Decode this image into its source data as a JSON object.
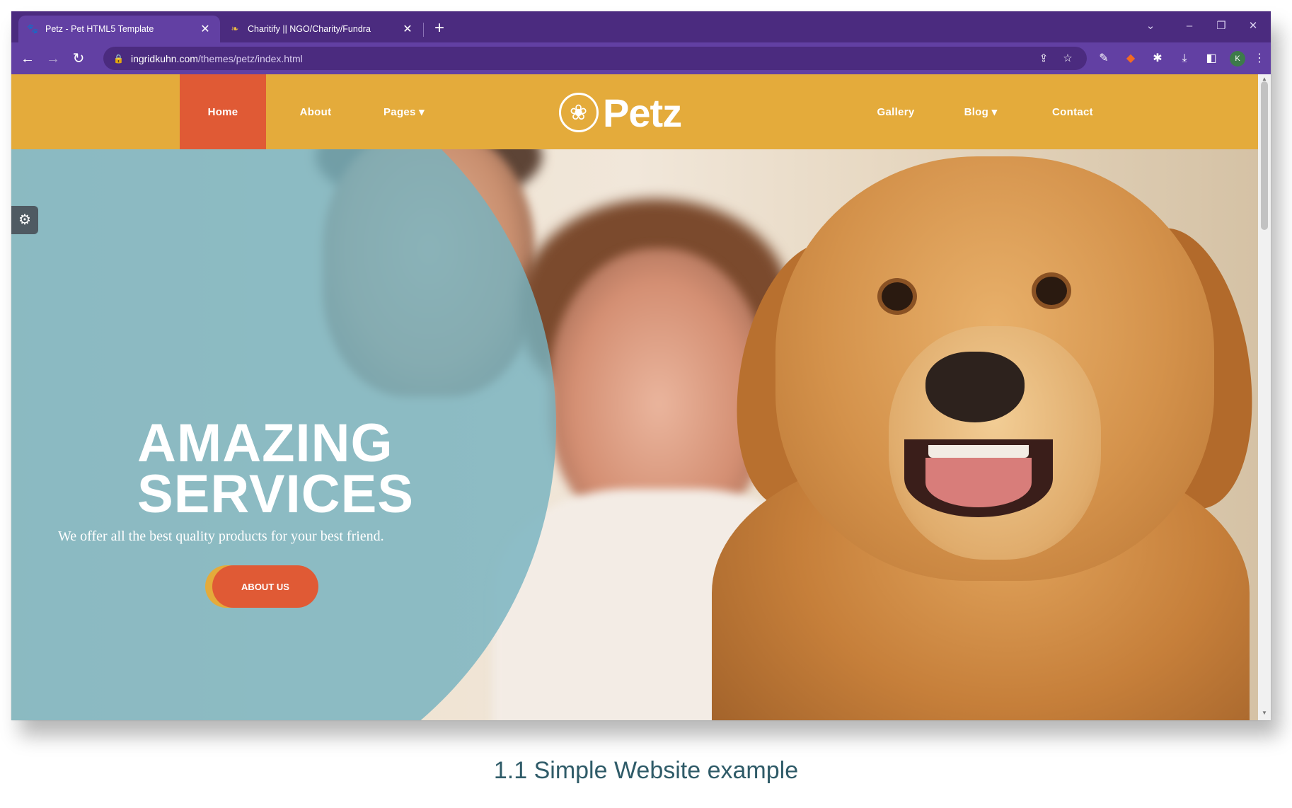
{
  "browser": {
    "tabs": [
      {
        "title": "Petz - Pet HTML5 Template",
        "icon": "paw-icon",
        "active": true
      },
      {
        "title": "Charitify || NGO/Charity/Fundra",
        "icon": "leaf-icon",
        "active": false
      }
    ],
    "url_host": "ingridkuhn.com",
    "url_path": "/themes/petz/index.html",
    "accent_color": "#6240a3"
  },
  "site": {
    "nav_left": [
      {
        "label": "Home",
        "active": true
      },
      {
        "label": "About"
      },
      {
        "label": "Pages ▾"
      }
    ],
    "logo_text": "Petz",
    "nav_right": [
      {
        "label": "Gallery"
      },
      {
        "label": "Blog ▾"
      },
      {
        "label": "Contact"
      }
    ],
    "header_color": "#e4ab3b",
    "active_color": "#e05a35"
  },
  "hero": {
    "title_line1": "AMAZING",
    "title_line2": "SERVICES",
    "subtitle": "We offer all the best quality products for your best friend.",
    "button_label": "ABOUT US"
  },
  "caption": "1.1 Simple Website example"
}
